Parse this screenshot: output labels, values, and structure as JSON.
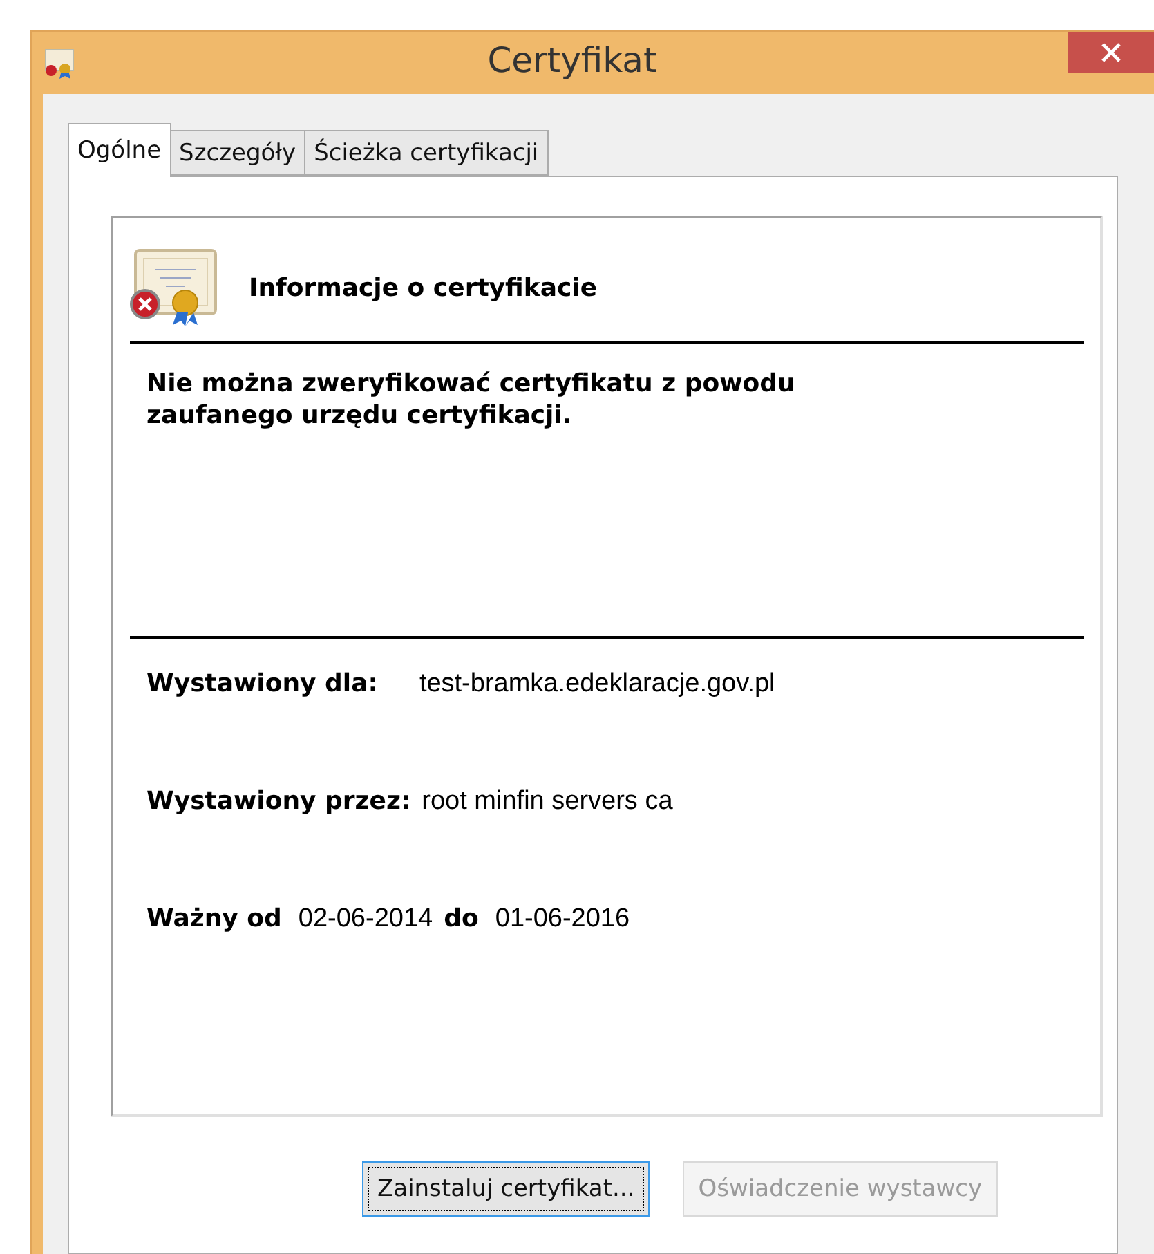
{
  "window": {
    "title": "Certyfikat"
  },
  "tabs": [
    {
      "label": "Ogólne",
      "selected": true
    },
    {
      "label": "Szczegóły",
      "selected": false
    },
    {
      "label": "Ścieżka certyfikacji",
      "selected": false
    }
  ],
  "info": {
    "heading": "Informacje o certyfikacie",
    "untrusted": true,
    "message": "Nie można zweryfikować certyfikatu z powodu zaufanego urzędu certyfikacji."
  },
  "fields": [
    {
      "label": "Wystawiony dla:",
      "value": "test-bramka.edeklaracje.gov.pl"
    },
    {
      "label": "Wystawiony przez:",
      "value": "root minfin servers ca"
    }
  ],
  "validity": {
    "from_label": "Ważny od",
    "from": "02-06-2014",
    "to_label": "do",
    "to": "01-06-2016"
  },
  "buttons": [
    {
      "label": "Zainstaluj certyfikat...",
      "disabled": false,
      "focused": true
    },
    {
      "label": "Oświadczenie wystawcy",
      "disabled": true,
      "focused": false
    }
  ]
}
